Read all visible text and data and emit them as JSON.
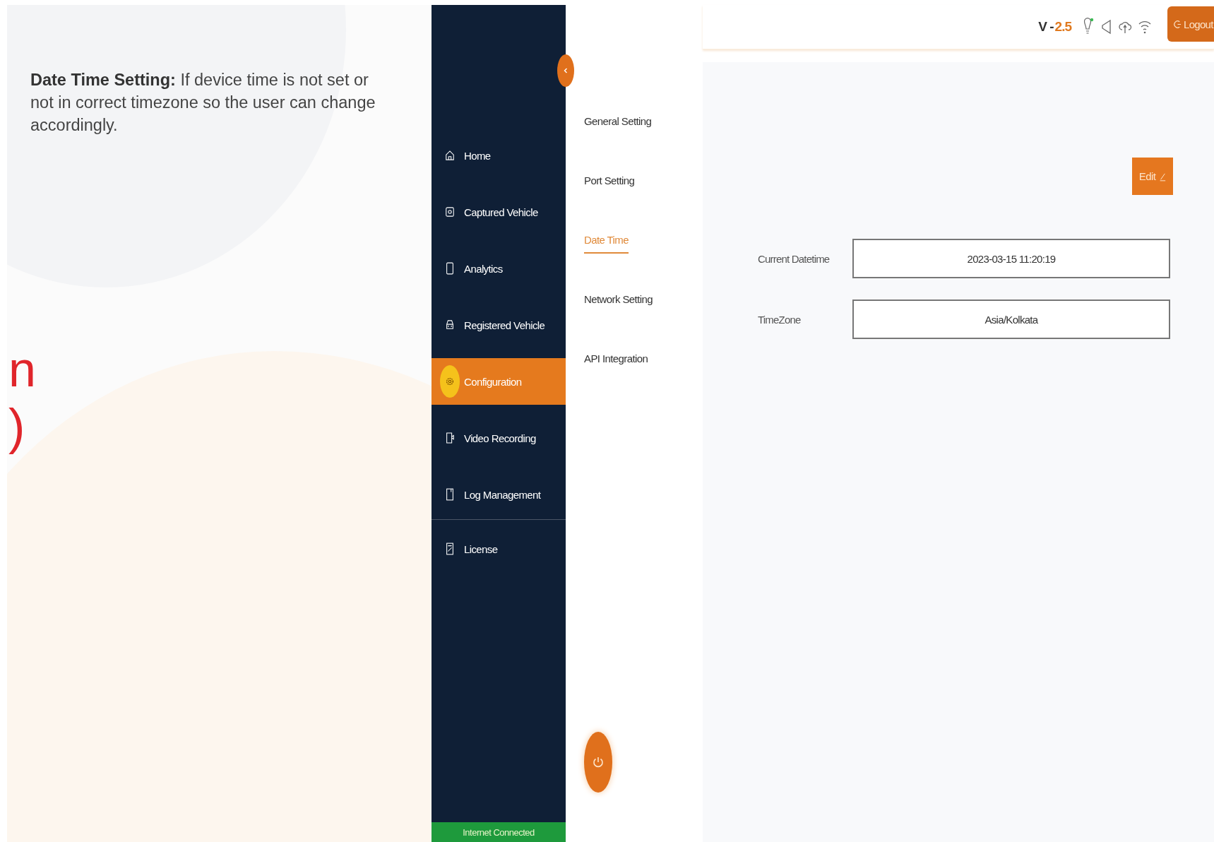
{
  "description": {
    "text": "**Date Time Setting:** If device time is not set or not in correct timezone so the user can change accordingly."
  },
  "cut_heading": [
    "n",
    ")"
  ],
  "sidebar": {
    "items": [
      {
        "label": "Home",
        "selected": false
      },
      {
        "label": "Captured Vehicle",
        "selected": false
      },
      {
        "label": "Analytics",
        "selected": false
      },
      {
        "label": "Registered Vehicle",
        "selected": false
      },
      {
        "label": "Configuration",
        "selected": true
      },
      {
        "label": "Video Recording",
        "selected": false
      },
      {
        "label": "Log Management",
        "selected": false
      },
      {
        "label": "License",
        "selected": false
      }
    ],
    "status": "Internet Connected"
  },
  "tabs": [
    {
      "label": "General Setting",
      "selected": false
    },
    {
      "label": "Port Setting",
      "selected": false
    },
    {
      "label": "Date Time",
      "selected": true
    },
    {
      "label": "Network Setting",
      "selected": false
    },
    {
      "label": "API Integration",
      "selected": false
    }
  ],
  "top_bar": {
    "version_prefix": "V -",
    "version_number": "2.5",
    "logout": "Logout"
  },
  "edit_button": "Edit",
  "fields": [
    {
      "label": "Current Datetime",
      "value": "2023-03-15 11:20:19"
    },
    {
      "label": "TimeZone",
      "value": "Asia/Kolkata"
    }
  ]
}
